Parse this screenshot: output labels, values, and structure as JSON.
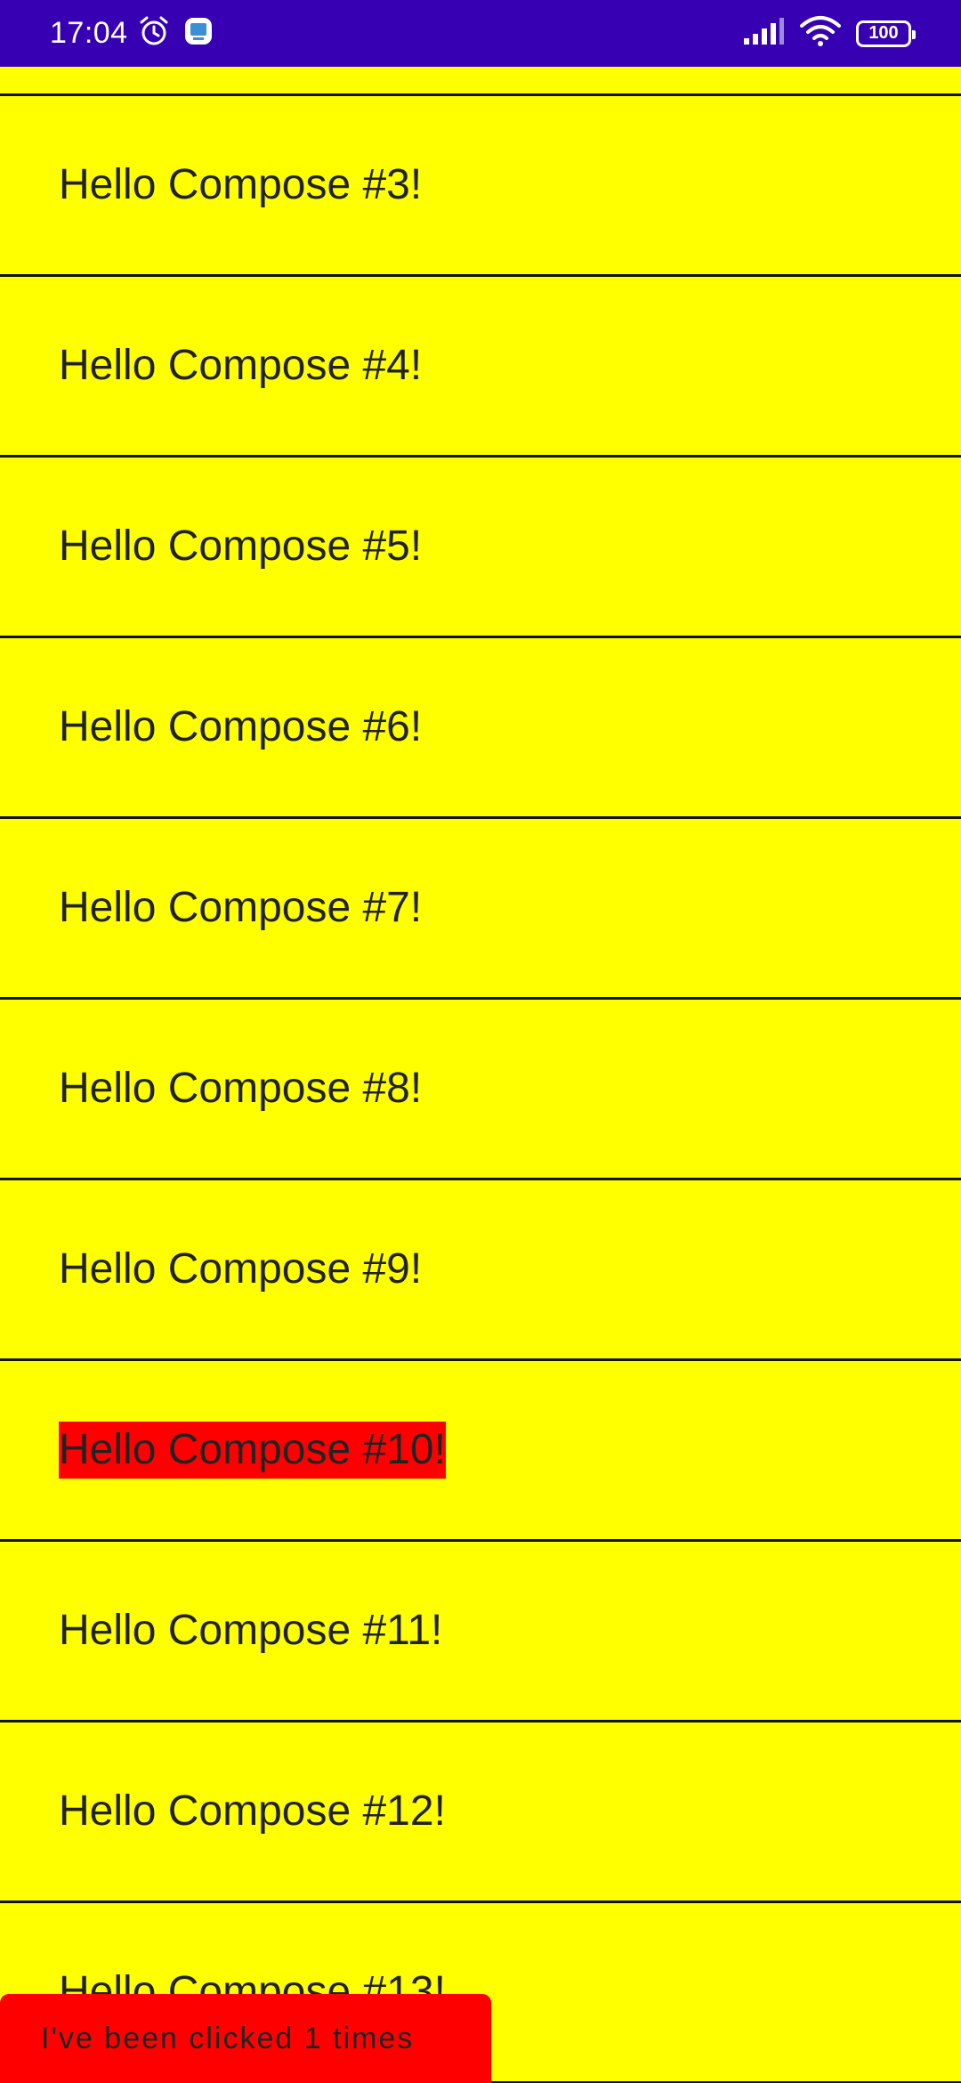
{
  "status_bar": {
    "time": "17:04",
    "battery": "100",
    "left_icons": [
      "alarm-icon",
      "app-notification-icon"
    ],
    "right_icons": [
      "signal-icon",
      "wifi-icon",
      "battery-icon"
    ],
    "color": "#3700b3"
  },
  "list": {
    "background": "#ffff00",
    "items": [
      {
        "label": "Hello Compose #3!",
        "highlighted": false
      },
      {
        "label": "Hello Compose #4!",
        "highlighted": false
      },
      {
        "label": "Hello Compose #5!",
        "highlighted": false
      },
      {
        "label": "Hello Compose #6!",
        "highlighted": false
      },
      {
        "label": "Hello Compose #7!",
        "highlighted": false
      },
      {
        "label": "Hello Compose #8!",
        "highlighted": false
      },
      {
        "label": "Hello Compose #9!",
        "highlighted": false
      },
      {
        "label": "Hello Compose #10!",
        "highlighted": true
      },
      {
        "label": "Hello Compose #11!",
        "highlighted": false
      },
      {
        "label": "Hello Compose #12!",
        "highlighted": false
      },
      {
        "label": "Hello Compose #13!",
        "highlighted": false
      }
    ]
  },
  "snackbar": {
    "text": "I've been clicked 1 times",
    "color": "#ff0000"
  }
}
